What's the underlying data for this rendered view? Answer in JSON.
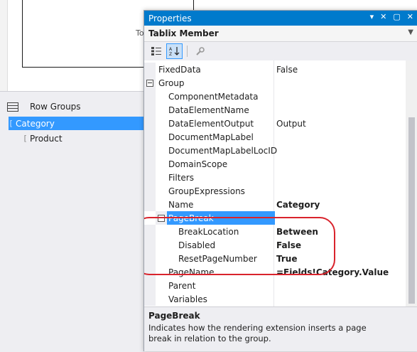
{
  "background": {
    "partial_text": "To",
    "row_groups_title": "Row Groups",
    "groups": [
      {
        "bracket": "[",
        "label": "Category"
      },
      {
        "bracket": "[",
        "label": "Product"
      }
    ]
  },
  "properties": {
    "title": "Properties",
    "window_controls": [
      "▾",
      "✕",
      "▢",
      "✕"
    ],
    "object_name": "Tablix Member",
    "toolbar_icons": [
      "categorized-icon",
      "alphabetical-sort-icon",
      "property-pages-icon"
    ],
    "rows": [
      {
        "name": "FixedData",
        "value": "False"
      },
      {
        "name": "Group",
        "value": ""
      },
      {
        "name": "ComponentMetadata",
        "value": ""
      },
      {
        "name": "DataElementName",
        "value": ""
      },
      {
        "name": "DataElementOutput",
        "value": "Output"
      },
      {
        "name": "DocumentMapLabel",
        "value": ""
      },
      {
        "name": "DocumentMapLabelLocID",
        "value": ""
      },
      {
        "name": "DomainScope",
        "value": ""
      },
      {
        "name": "Filters",
        "value": ""
      },
      {
        "name": "GroupExpressions",
        "value": ""
      },
      {
        "name": "Name",
        "value": "Category"
      },
      {
        "name": "PageBreak",
        "value": ""
      },
      {
        "name": "BreakLocation",
        "value": "Between"
      },
      {
        "name": "Disabled",
        "value": "False"
      },
      {
        "name": "ResetPageNumber",
        "value": "True"
      },
      {
        "name": "PageName",
        "value": "=Fields!Category.Value"
      },
      {
        "name": "Parent",
        "value": ""
      },
      {
        "name": "Variables",
        "value": ""
      }
    ],
    "description": {
      "title": "PageBreak",
      "text": "Indicates how the rendering extension inserts a page break in relation to the group."
    }
  },
  "colors": {
    "title_bar": "#007acc",
    "selection": "#3399ff",
    "highlight_ellipse": "#d9232c"
  }
}
